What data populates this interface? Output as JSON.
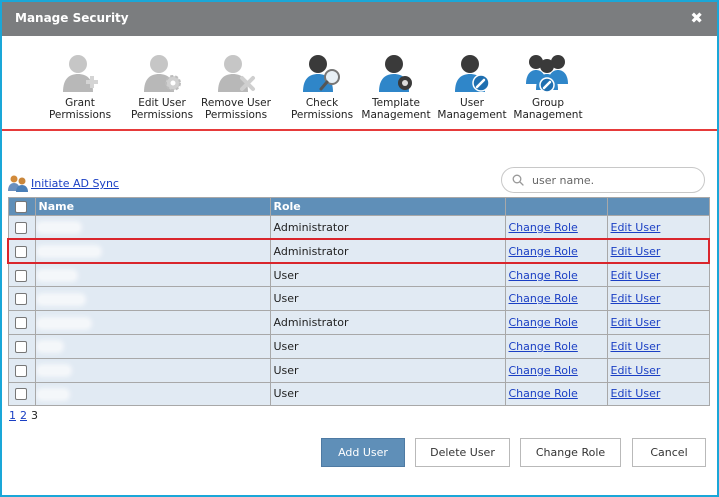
{
  "dialog": {
    "title": "Manage Security",
    "close_label": "✖"
  },
  "toolbar": {
    "items": [
      {
        "label1": "Grant",
        "label2": "Permissions",
        "icon": "grant-permissions-icon"
      },
      {
        "label1": "Edit User",
        "label2": "Permissions",
        "icon": "edit-user-permissions-icon"
      },
      {
        "label1": "Remove User",
        "label2": "Permissions",
        "icon": "remove-user-permissions-icon"
      },
      {
        "label1": "Check",
        "label2": "Permissions",
        "icon": "check-permissions-icon"
      },
      {
        "label1": "Template",
        "label2": "Management",
        "icon": "template-management-icon"
      },
      {
        "label1": "User",
        "label2": "Management",
        "icon": "user-management-icon"
      },
      {
        "label1": "Group",
        "label2": "Management",
        "icon": "group-management-icon"
      }
    ]
  },
  "ad_sync": {
    "label": "Initiate AD Sync",
    "icon": "ad-sync-users-icon"
  },
  "search": {
    "placeholder": "user name.",
    "value": "",
    "icon": "search-icon"
  },
  "table": {
    "columns": {
      "name": "Name",
      "role": "Role",
      "change": "",
      "edit": ""
    },
    "rows": [
      {
        "role": "Administrator",
        "change_role": "Change Role",
        "edit_user": "Edit User"
      },
      {
        "role": "Administrator",
        "change_role": "Change Role",
        "edit_user": "Edit User"
      },
      {
        "role": "User",
        "change_role": "Change Role",
        "edit_user": "Edit User"
      },
      {
        "role": "User",
        "change_role": "Change Role",
        "edit_user": "Edit User"
      },
      {
        "role": "Administrator",
        "change_role": "Change Role",
        "edit_user": "Edit User"
      },
      {
        "role": "User",
        "change_role": "Change Role",
        "edit_user": "Edit User"
      },
      {
        "role": "User",
        "change_role": "Change Role",
        "edit_user": "Edit User"
      },
      {
        "role": "User",
        "change_role": "Change Role",
        "edit_user": "Edit User"
      }
    ],
    "selected_row": 2
  },
  "pager": {
    "pages": [
      "1",
      "2",
      "3"
    ]
  },
  "buttons": {
    "add_user": "Add User",
    "delete_user": "Delete User",
    "change_role": "Change Role",
    "cancel": "Cancel"
  },
  "colors": {
    "titlebar": "#7b7d7f",
    "header": "#5f8fb8",
    "row": "#e1eaf3",
    "highlight": "#d9252c",
    "accent_line": "#e63a3a"
  }
}
